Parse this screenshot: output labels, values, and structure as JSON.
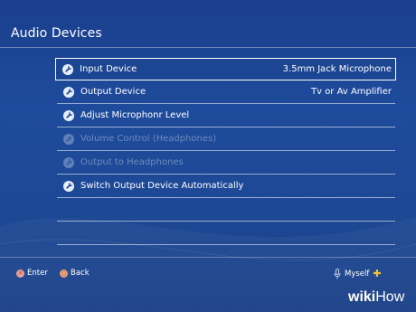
{
  "screen": {
    "title": "Audio Devices"
  },
  "menu": {
    "items": [
      {
        "label": "Input Device",
        "value": "3.5mm Jack Microphone",
        "state": "selected",
        "icon": "wrench-icon"
      },
      {
        "label": "Output Device",
        "value": "Tv or Av Amplifier",
        "state": "enabled",
        "icon": "wrench-icon"
      },
      {
        "label": "Adjust Microphonr Level",
        "value": "",
        "state": "enabled",
        "icon": "wrench-icon"
      },
      {
        "label": "Volume Control (Headphones)",
        "value": "",
        "state": "disabled",
        "icon": "wrench-icon"
      },
      {
        "label": "Output to Headphones",
        "value": "",
        "state": "disabled",
        "icon": "wrench-icon"
      },
      {
        "label": "Switch Output Device Automatically",
        "value": "",
        "state": "enabled",
        "icon": "wrench-icon"
      }
    ]
  },
  "footer": {
    "enter": {
      "label": "Enter",
      "icon": "cross-button-icon"
    },
    "back": {
      "label": "Back",
      "icon": "circle-button-icon"
    },
    "user": {
      "name": "Myself",
      "icon": "microphone-icon",
      "badge": "playstation-plus-icon"
    }
  },
  "watermark": {
    "part1": "wiki",
    "part2": "How"
  },
  "colors": {
    "background": "#1f4b9c",
    "plus": "#f2c232"
  }
}
